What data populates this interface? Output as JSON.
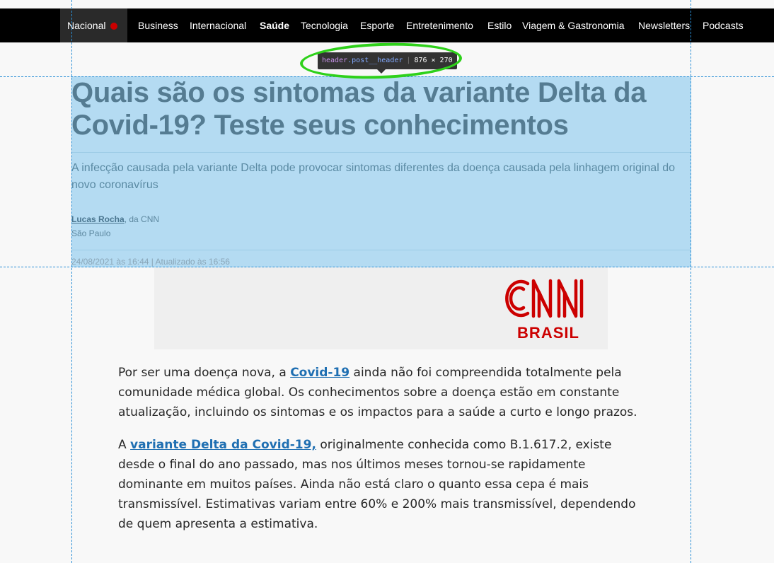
{
  "nav": {
    "items": [
      {
        "label": "Nacional",
        "live": true
      },
      {
        "label": "Business"
      },
      {
        "label": "Internacional"
      },
      {
        "label": "Saúde",
        "active": true
      },
      {
        "label": "Tecnologia"
      },
      {
        "label": "Esporte"
      },
      {
        "label": "Entretenimento"
      },
      {
        "label": "Estilo"
      },
      {
        "label": "Viagem & Gastronomia"
      },
      {
        "label": "Newsletters"
      },
      {
        "label": "Podcasts"
      }
    ]
  },
  "devtools": {
    "tag": "header",
    "class_name": ".post__header",
    "dimensions": "876 × 270",
    "highlight_color": "#6fbeec"
  },
  "header": {
    "title": "Quais são os sintomas da variante Delta da Covid-19? Teste seus conhecimentos",
    "subtitle": "A infecção causada pela variante Delta pode provocar sintomas diferentes da doença causada pela linhagem original do novo coronavírus",
    "author": "Lucas Rocha",
    "author_suffix": ", da CNN",
    "location": "São Paulo",
    "dateline": "24/08/2021 às 16:44 | Atualizado às 16:56"
  },
  "logo": {
    "brand": "CNN",
    "subtext": "BRASIL",
    "color": "#cc0000"
  },
  "article": {
    "p1_before": "Por ser uma doença nova, a ",
    "p1_link": "Covid-19",
    "p1_after": " ainda não foi compreendida totalmente pela comunidade médica global. Os conhecimentos sobre a doença estão em constante atualização, incluindo os sintomas e os impactos para a saúde a curto e longo prazos.",
    "p2_before": "A ",
    "p2_link": "variante Delta da Covid-19,",
    "p2_after": " originalmente conhecida como B.1.617.2, existe desde o final do ano passado, mas nos últimos meses tornou-se rapidamente dominante em muitos países. Ainda não está claro o quanto essa cepa é mais transmissível. Estimativas variam entre 60% e 200% mais transmissível, dependendo de quem apresenta a estimativa."
  }
}
